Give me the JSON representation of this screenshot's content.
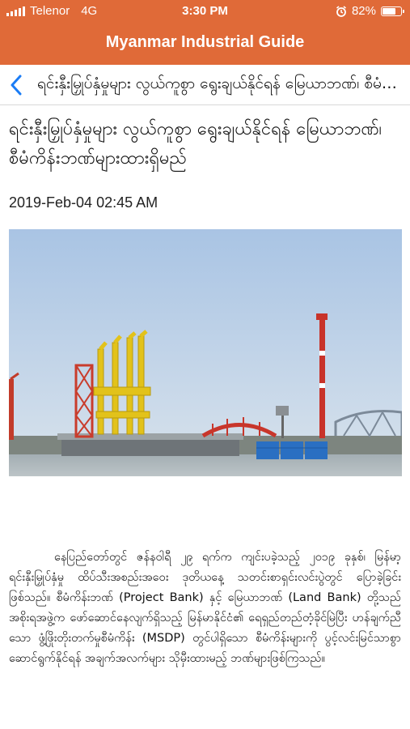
{
  "status": {
    "carrier": "Telenor",
    "network": "4G",
    "time": "3:30 PM",
    "battery_percent": "82%",
    "battery_level": 0.82,
    "icons": [
      "signal-icon",
      "alarm-icon",
      "battery-icon"
    ]
  },
  "app": {
    "title": "Myanmar Industrial Guide",
    "accent_color": "#e06a38"
  },
  "nav": {
    "back_icon": "chevron-left-icon",
    "title": "ရင်းနှီးမြှုပ်နှံမှုများ လွယ်ကူစွာ ရွေးချယ်နိုင်ရန် မြေယာဘဏ်၊ စီမံကိန်းဘဏ်များထားရှိမည်"
  },
  "article": {
    "headline": "ရင်းနှီးမြှုပ်နှံမှုများ လွယ်ကူစွာ ရွေးချယ်နိုင်ရန် မြေယာဘဏ်၊ စီမံကိန်းဘဏ်များထားရှိမည်",
    "date": "2019-Feb-04 02:45 AM",
    "image_subject": "port cranes and harbor",
    "body": "နေပြည်တော်တွင် ဇန်နဝါရီ ၂၉ ရက်က ကျင်းပခဲ့သည့် ၂၀၁၉ ခုနှစ်၊ မြန်မာ့ရင်းနှီးမြှုပ်နှံမှု ထိပ်သီးအစည်းအဝေး ဒုတိယနေ့ သတင်းစာရှင်းလင်းပွဲတွင် ပြောခဲ့ခြင်းဖြစ်သည်။ စီမံကိန်းဘဏ် (Project Bank) နှင့် မြေယာဘဏ် (Land Bank) တို့သည် အစိုးရအဖွဲ့က ဖော်ဆောင်နေလျက်ရှိသည့် မြန်မာနိုင်ငံ၏ ရေရှည်တည်တံ့ခိုင်မြဲပြီး ဟန်ချက်ညီသော ဖွံ့ဖြိုးတိုးတက်မှုစီမံကိန်း (MSDP) တွင်ပါရှိသော စီမံကိန်းများကို ပွင့်လင်းမြင်သာစွာ ဆောင်ရွက်နိုင်ရန် အချက်အလက်များ သိုမှီးထားမည့် ဘဏ်များဖြစ်ကြသည်။"
  }
}
